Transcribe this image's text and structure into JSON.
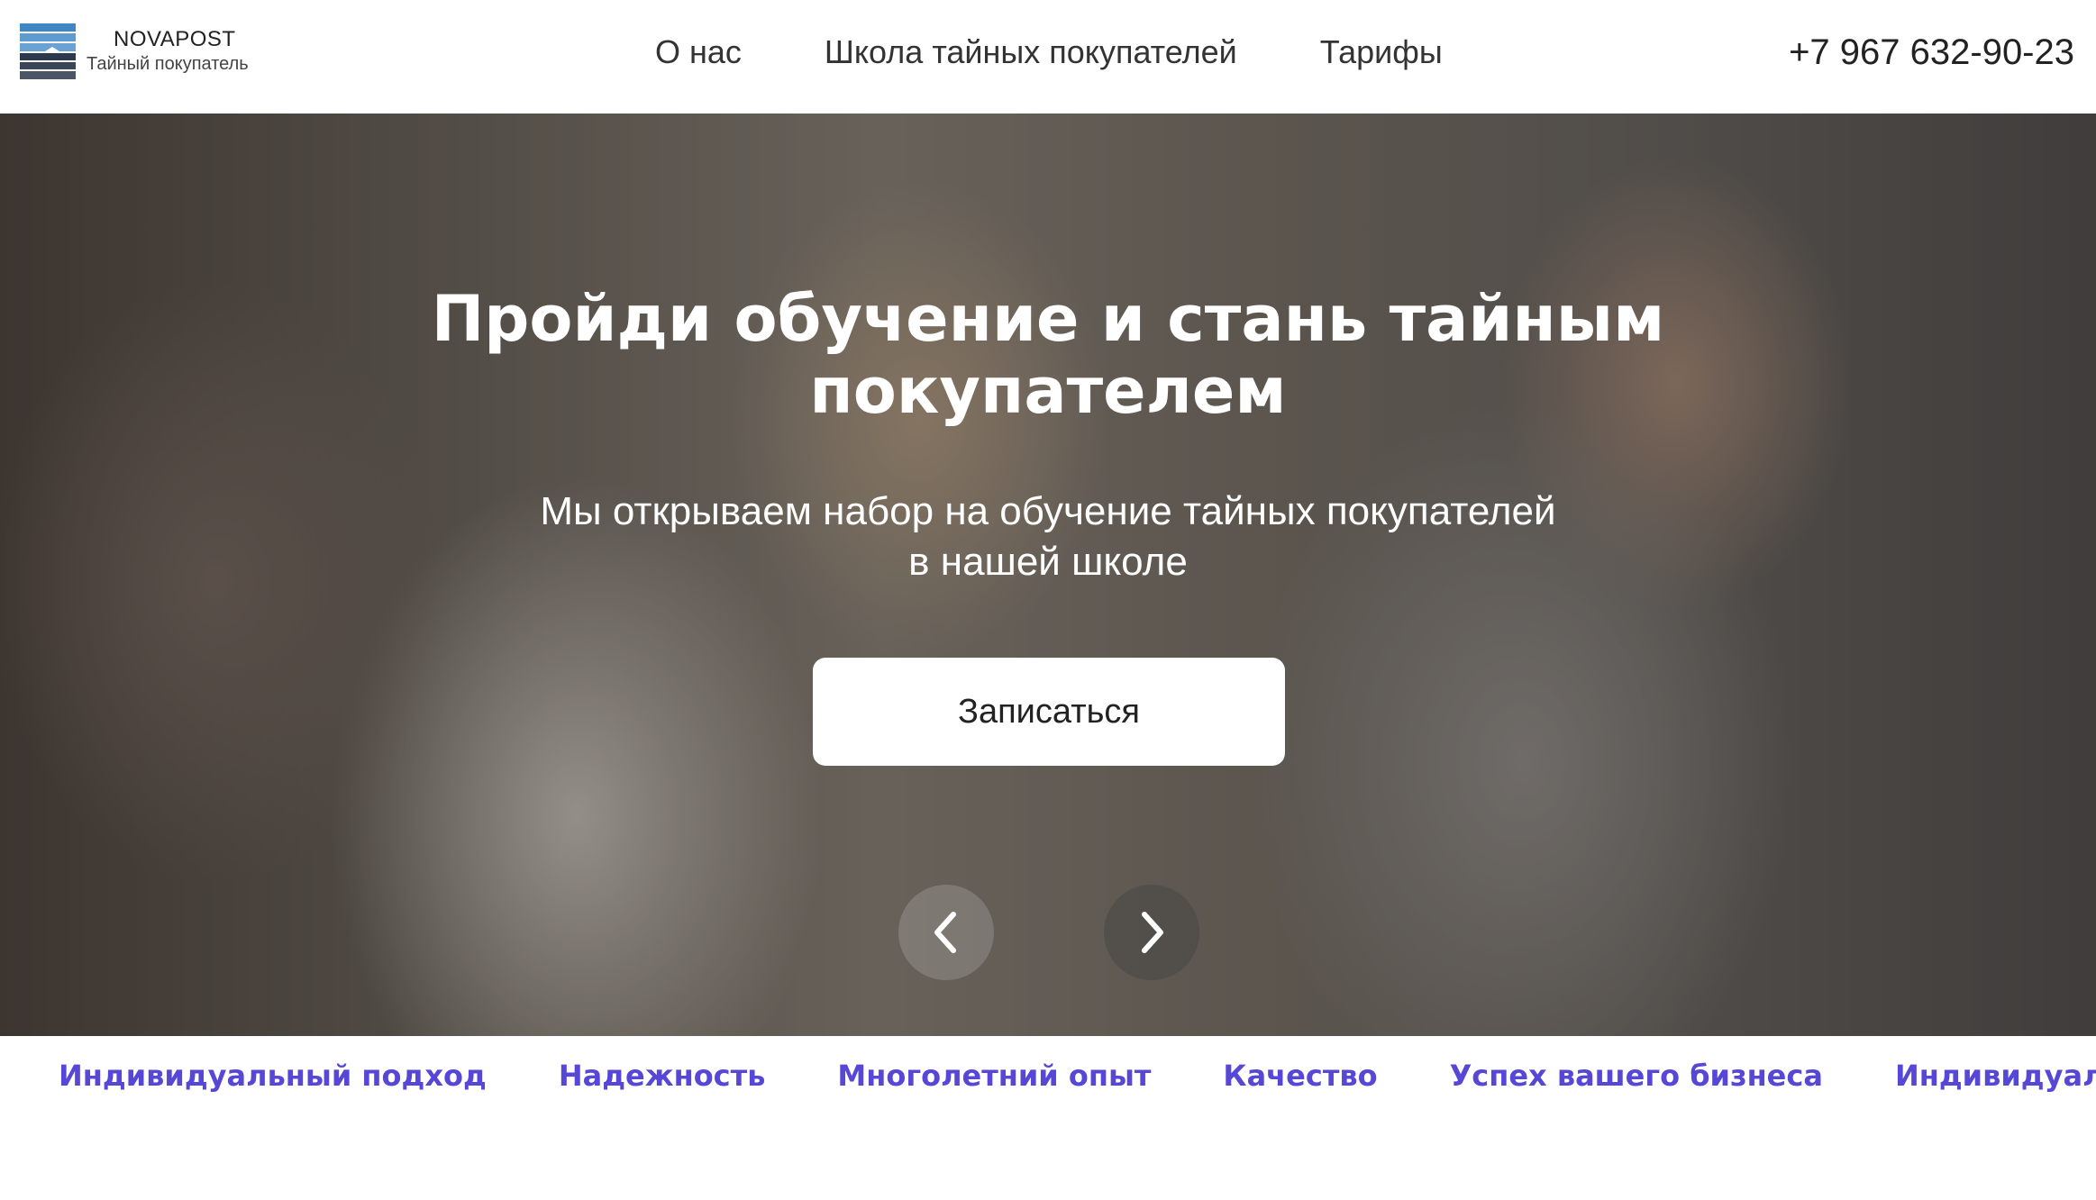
{
  "header": {
    "logo_name": "NOVAPOST",
    "logo_sub": "Тайный покупатель",
    "nav": [
      {
        "label": "О нас"
      },
      {
        "label": "Школа тайных покупателей"
      },
      {
        "label": "Тарифы"
      }
    ],
    "phone": "+7 967 632-90-23"
  },
  "hero": {
    "title_line1": "Пройди обучение и стань тайным",
    "title_line2": "покупателем",
    "sub_line1": "Мы открываем набор на обучение тайных покупателей",
    "sub_line2": "в нашей школе",
    "cta_label": "Записаться",
    "prev_icon": "chevron-left-icon",
    "next_icon": "chevron-right-icon"
  },
  "ticker": {
    "items": [
      "Индивидуальный подход",
      "Надежность",
      "Многолетний опыт",
      "Качество",
      "Успех вашего бизнеса",
      "Индивидуальный подход"
    ]
  },
  "colors": {
    "accent": "#5647d6",
    "text": "#222222",
    "cta_bg": "#ffffff"
  }
}
